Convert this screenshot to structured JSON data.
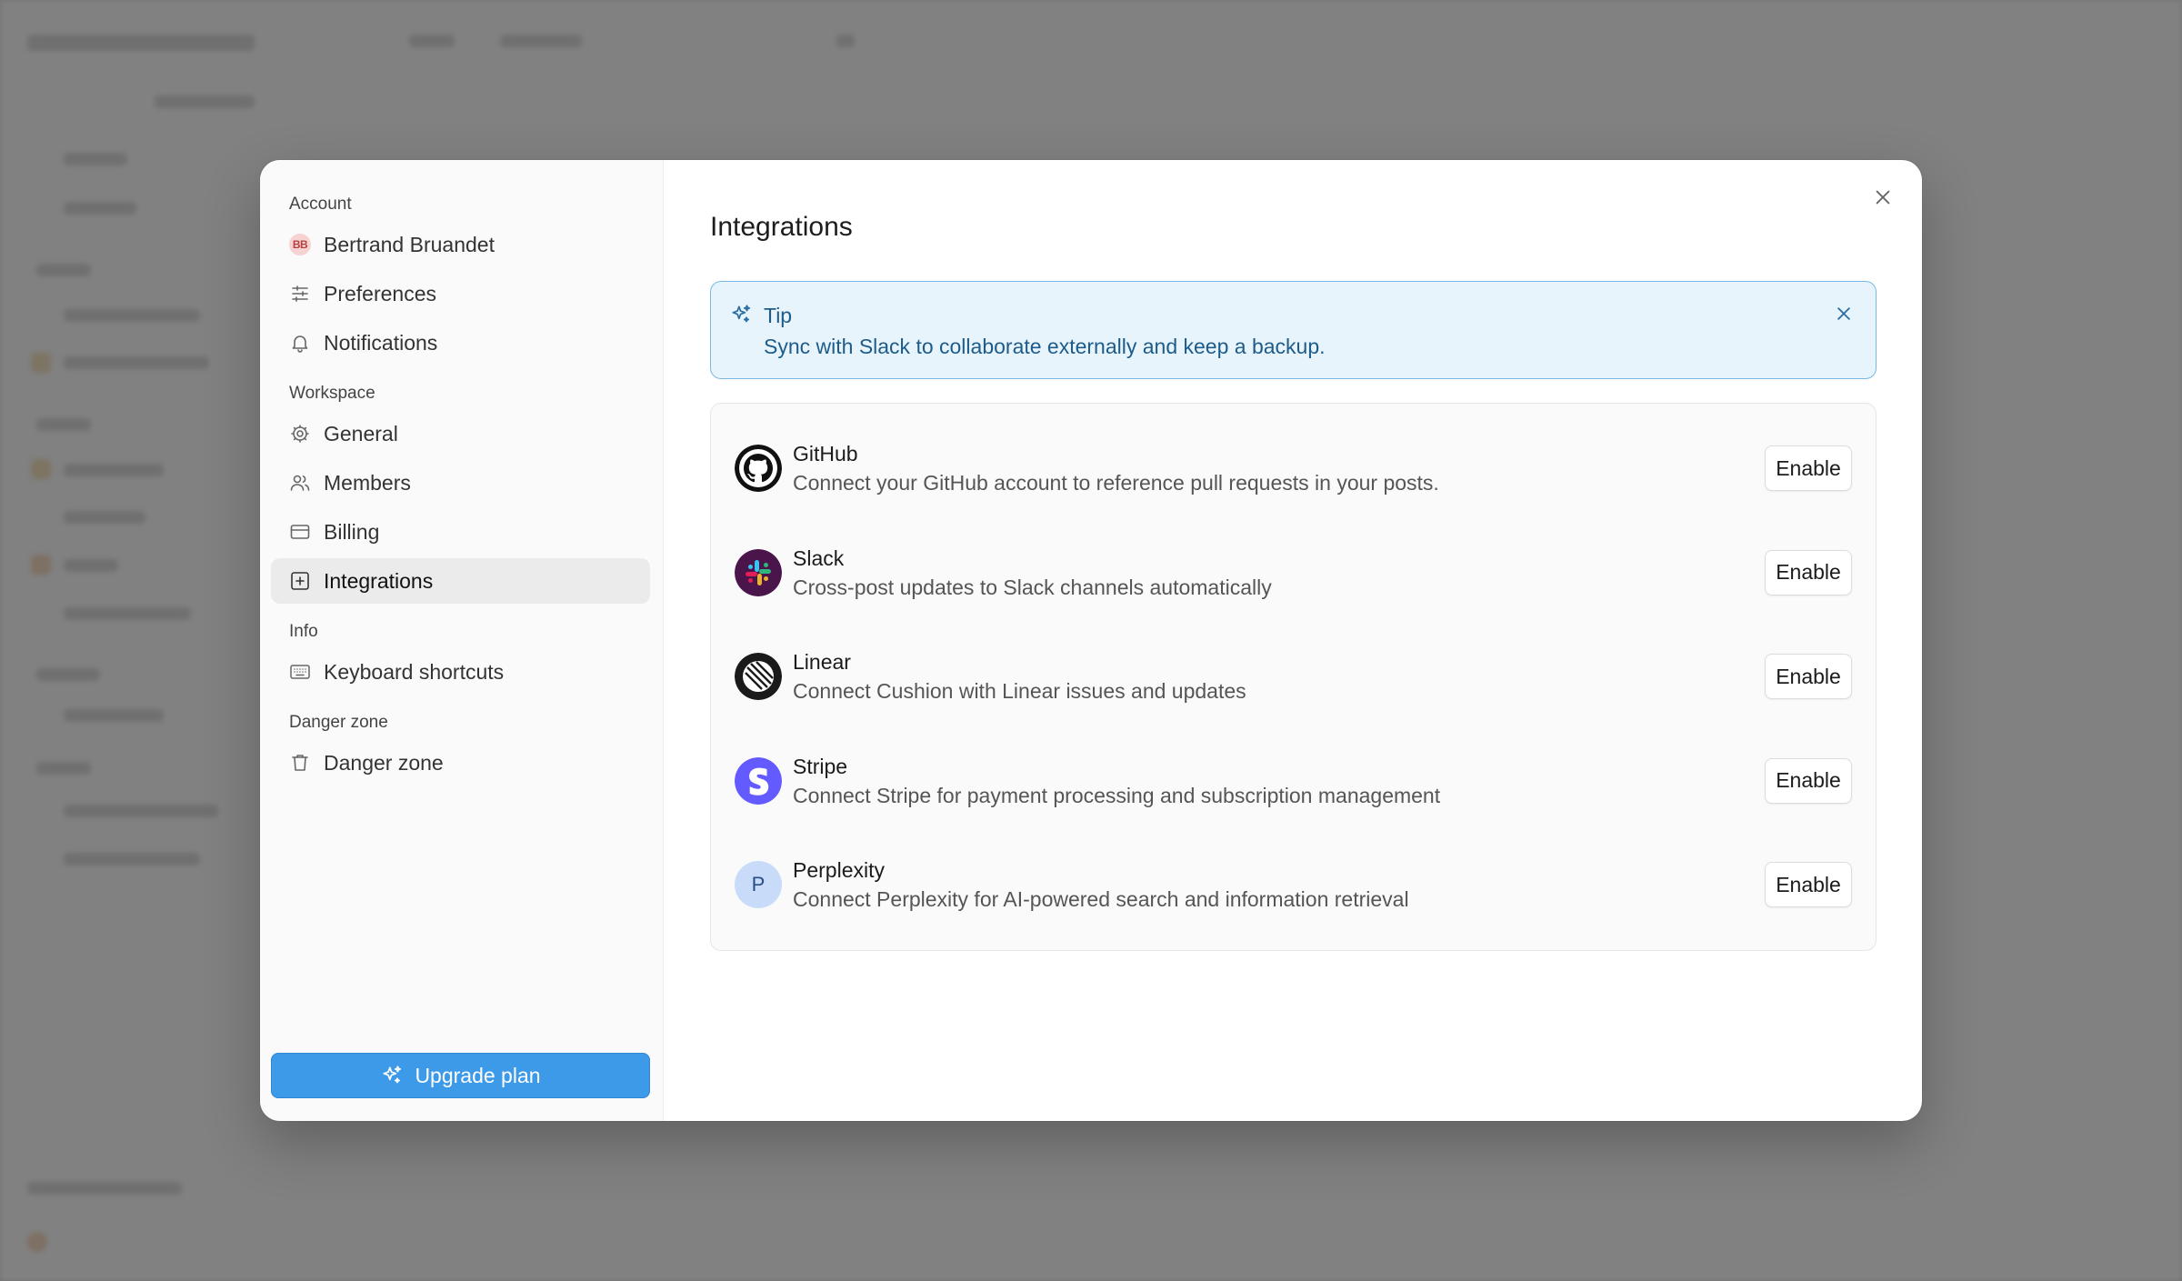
{
  "modal": {
    "sidebar": {
      "sections": [
        {
          "title": "Account",
          "items": [
            {
              "label": "Bertrand Bruandet",
              "icon": "avatar",
              "initials": "BB"
            },
            {
              "label": "Preferences",
              "icon": "sliders-icon"
            },
            {
              "label": "Notifications",
              "icon": "bell-icon"
            }
          ]
        },
        {
          "title": "Workspace",
          "items": [
            {
              "label": "General",
              "icon": "gear-icon"
            },
            {
              "label": "Members",
              "icon": "users-icon"
            },
            {
              "label": "Billing",
              "icon": "credit-card-icon"
            },
            {
              "label": "Integrations",
              "icon": "plus-square-icon",
              "active": true
            }
          ]
        },
        {
          "title": "Info",
          "items": [
            {
              "label": "Keyboard shortcuts",
              "icon": "keyboard-icon"
            }
          ]
        },
        {
          "title": "Danger zone",
          "items": [
            {
              "label": "Danger zone",
              "icon": "trash-icon"
            }
          ]
        }
      ],
      "upgrade_label": "Upgrade plan"
    },
    "main": {
      "title": "Integrations",
      "tip": {
        "title": "Tip",
        "text": "Sync with Slack to collaborate externally and keep a backup."
      },
      "integrations": [
        {
          "name": "GitHub",
          "description": "Connect your GitHub account to reference pull requests in your posts.",
          "button": "Enable",
          "icon": "github-icon"
        },
        {
          "name": "Slack",
          "description": "Cross-post updates to Slack channels automatically",
          "button": "Enable",
          "icon": "slack-icon"
        },
        {
          "name": "Linear",
          "description": "Connect Cushion with Linear issues and updates",
          "button": "Enable",
          "icon": "linear-icon"
        },
        {
          "name": "Stripe",
          "description": "Connect Stripe for payment processing and subscription management",
          "button": "Enable",
          "icon": "stripe-icon"
        },
        {
          "name": "Perplexity",
          "description": "Connect Perplexity for AI-powered search and information retrieval",
          "button": "Enable",
          "icon": "perplexity-icon",
          "letter": "P"
        }
      ]
    }
  },
  "colors": {
    "accent": "#3d9ae8",
    "tip_bg": "#e8f4fc",
    "tip_border": "#79b8e2",
    "active_item_bg": "#ebebeb"
  }
}
